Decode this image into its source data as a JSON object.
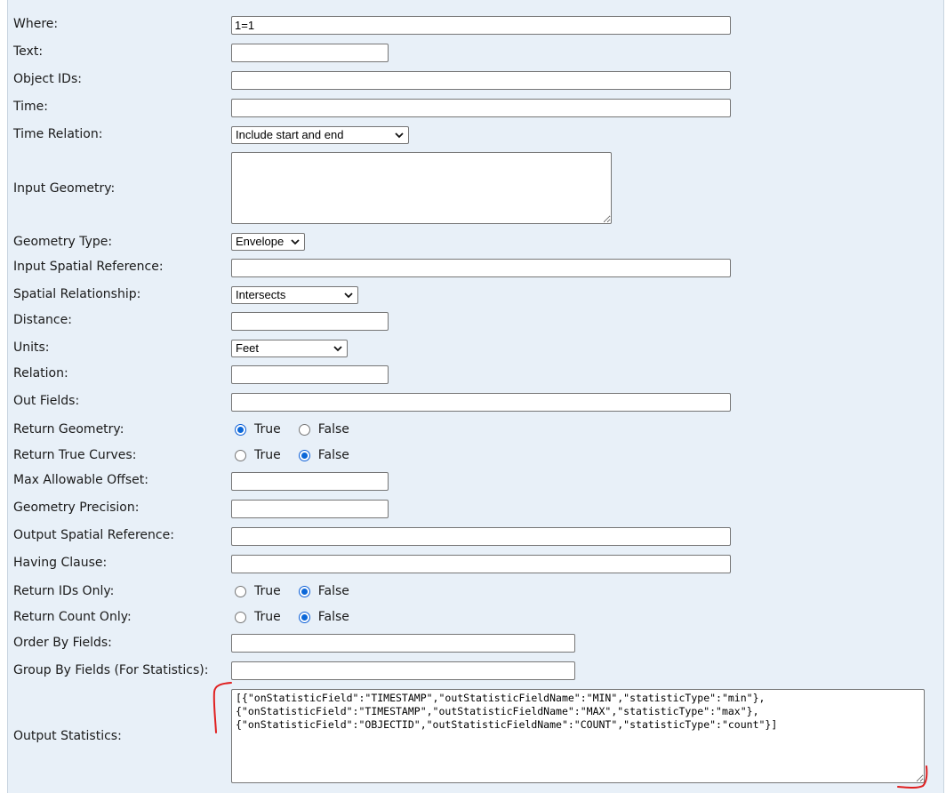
{
  "form": {
    "where": {
      "label": "Where:",
      "value": "1=1"
    },
    "text": {
      "label": "Text:",
      "value": ""
    },
    "object_ids": {
      "label": "Object IDs:",
      "value": ""
    },
    "time": {
      "label": "Time:",
      "value": ""
    },
    "time_relation": {
      "label": "Time Relation:",
      "selected": "Include start and end"
    },
    "input_geometry": {
      "label": "Input Geometry:",
      "value": ""
    },
    "geometry_type": {
      "label": "Geometry Type:",
      "selected": "Envelope"
    },
    "input_spatial_reference": {
      "label": "Input Spatial Reference:",
      "value": ""
    },
    "spatial_relationship": {
      "label": "Spatial Relationship:",
      "selected": "Intersects"
    },
    "distance": {
      "label": "Distance:",
      "value": ""
    },
    "units": {
      "label": "Units:",
      "selected": "Feet"
    },
    "relation": {
      "label": "Relation:",
      "value": ""
    },
    "out_fields": {
      "label": "Out Fields:",
      "value": ""
    },
    "return_geometry": {
      "label": "Return Geometry:",
      "true_label": "True",
      "false_label": "False",
      "selected": "True"
    },
    "return_true_curves": {
      "label": "Return True Curves:",
      "true_label": "True",
      "false_label": "False",
      "selected": "False"
    },
    "max_allowable_offset": {
      "label": "Max Allowable Offset:",
      "value": ""
    },
    "geometry_precision": {
      "label": "Geometry Precision:",
      "value": ""
    },
    "output_spatial_reference": {
      "label": "Output Spatial Reference:",
      "value": ""
    },
    "having_clause": {
      "label": "Having Clause:",
      "value": ""
    },
    "return_ids_only": {
      "label": "Return IDs Only:",
      "true_label": "True",
      "false_label": "False",
      "selected": "False"
    },
    "return_count_only": {
      "label": "Return Count Only:",
      "true_label": "True",
      "false_label": "False",
      "selected": "False"
    },
    "order_by_fields": {
      "label": "Order By Fields:",
      "value": ""
    },
    "group_by_fields": {
      "label": "Group By Fields (For Statistics):",
      "value": ""
    },
    "output_statistics": {
      "label": "Output Statistics:",
      "value": "[{\"onStatisticField\":\"TIMESTAMP\",\"outStatisticFieldName\":\"MIN\",\"statisticType\":\"min\"},\n{\"onStatisticField\":\"TIMESTAMP\",\"outStatisticFieldName\":\"MAX\",\"statisticType\":\"max\"},\n{\"onStatisticField\":\"OBJECTID\",\"outStatisticFieldName\":\"COUNT\",\"statisticType\":\"count\"}]"
    }
  },
  "colors": {
    "panel_background": "#e8f0f8",
    "radio_accent": "#0b67d8",
    "annotation": "#e02020"
  },
  "icons": {
    "select_arrow": "chevron-down-icon",
    "textarea_resize": "resize-grip-icon"
  }
}
